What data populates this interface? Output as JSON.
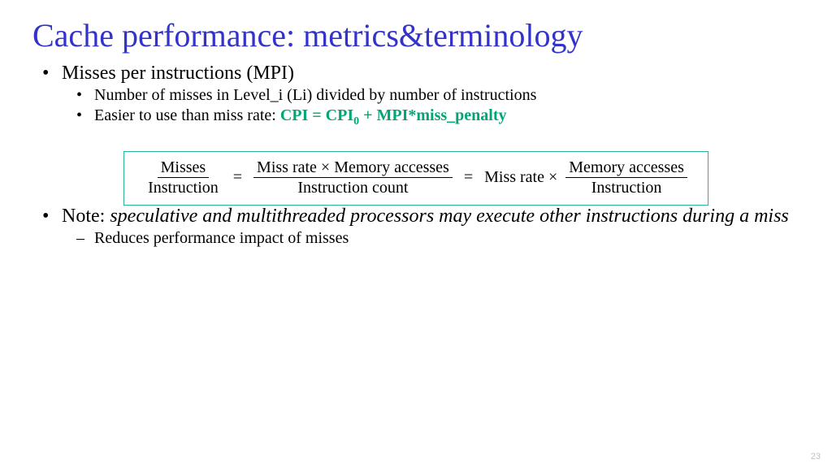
{
  "title": "Cache performance: metrics&terminology",
  "bullets": {
    "b1": "Misses per instructions (MPI)",
    "b1_sub1": "Number of misses in Level_i (Li) divided by number of instructions",
    "b1_sub2_prefix": "Easier to use than miss rate: ",
    "b1_sub2_formula_a": "CPI = CPI",
    "b1_sub2_formula_sub": "0",
    "b1_sub2_formula_b": " + MPI*miss_penalty",
    "b2_prefix": "Note: ",
    "b2_italic": "speculative and multithreaded processors may execute other instructions during a miss",
    "b2_sub1": "Reduces performance impact of misses"
  },
  "formula": {
    "frac1_num": "Misses",
    "frac1_den": "Instruction",
    "eq1": "=",
    "frac2_num": "Miss rate × Memory accesses",
    "frac2_den": "Instruction count",
    "eq2": "=",
    "mid": "Miss rate ×",
    "frac3_num": "Memory accesses",
    "frac3_den": "Instruction"
  },
  "page_number": "23"
}
